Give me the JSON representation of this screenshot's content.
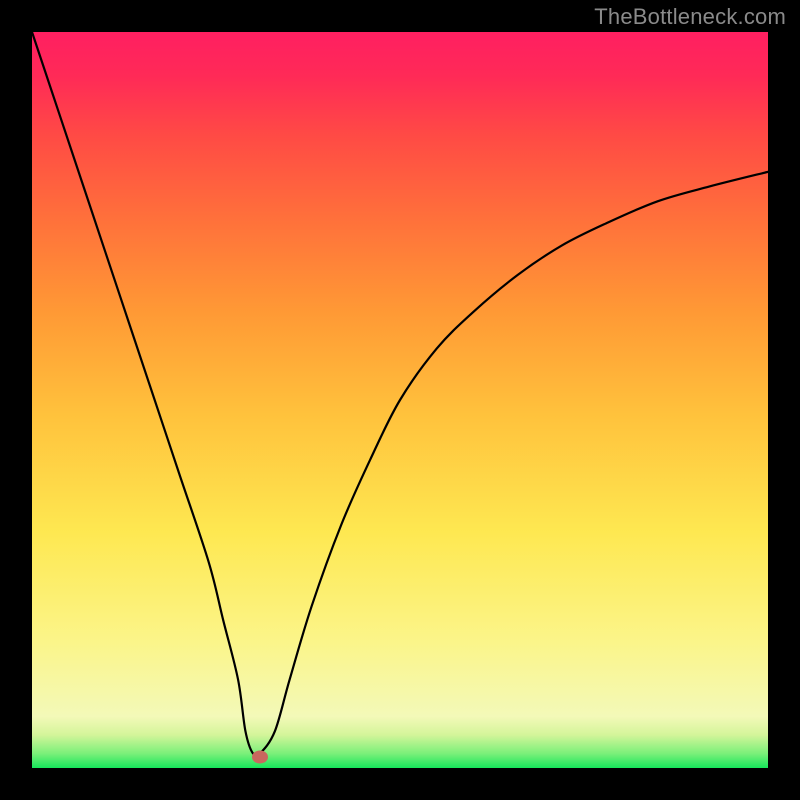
{
  "watermark": "TheBottleneck.com",
  "gradient_legend": {
    "top_color": "#ff1f61",
    "bottom_color": "#16e65b",
    "meaning_top": "high-bottleneck",
    "meaning_bottom": "no-bottleneck"
  },
  "chart_data": {
    "type": "line",
    "title": "",
    "xlabel": "",
    "ylabel": "",
    "xlim": [
      0,
      100
    ],
    "ylim": [
      0,
      100
    ],
    "grid": false,
    "legend": false,
    "annotations": [],
    "series": [
      {
        "name": "bottleneck-curve",
        "x": [
          0,
          4,
          8,
          12,
          16,
          20,
          24,
          26,
          28,
          29,
          30,
          31,
          33,
          35,
          38,
          42,
          46,
          50,
          55,
          60,
          66,
          72,
          78,
          85,
          92,
          100
        ],
        "y": [
          100,
          88,
          76,
          64,
          52,
          40,
          28,
          20,
          12,
          5,
          2,
          2,
          5,
          12,
          22,
          33,
          42,
          50,
          57,
          62,
          67,
          71,
          74,
          77,
          79,
          81
        ]
      }
    ],
    "marker": {
      "x": 31,
      "y": 1.5
    }
  }
}
